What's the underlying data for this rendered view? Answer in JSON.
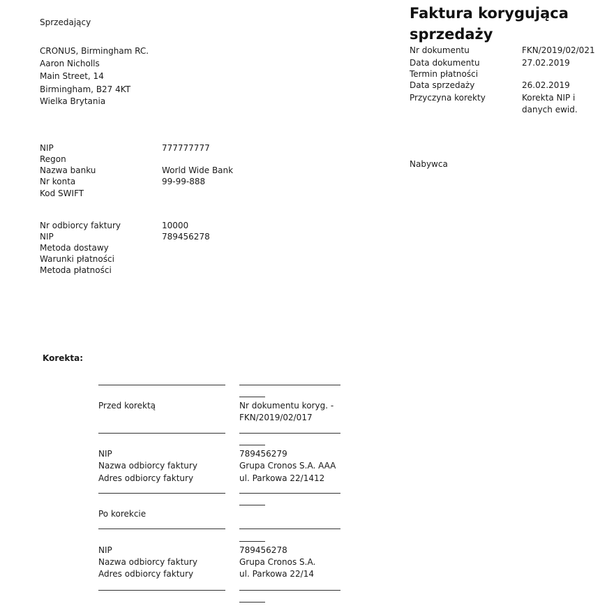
{
  "seller": {
    "heading": "Sprzedający",
    "address": [
      "CRONUS, Birmingham RC.",
      "Aaron Nicholls",
      "Main Street, 14",
      "Birmingham, B27 4KT",
      "Wielka Brytania"
    ]
  },
  "seller_details": [
    {
      "label": "NIP",
      "value": "777777777"
    },
    {
      "label": "Regon",
      "value": ""
    },
    {
      "label": "Nazwa banku",
      "value": "World Wide Bank"
    },
    {
      "label": "Nr konta",
      "value": "99-99-888"
    },
    {
      "label": "Kod SWIFT",
      "value": ""
    }
  ],
  "buyer_details": [
    {
      "label": "Nr odbiorcy faktury",
      "value": "10000"
    },
    {
      "label": "NIP",
      "value": "789456278"
    },
    {
      "label": "Metoda dostawy",
      "value": ""
    },
    {
      "label": "Warunki płatności",
      "value": ""
    },
    {
      "label": "Metoda płatności",
      "value": ""
    }
  ],
  "invoice": {
    "title": "Faktura korygująca sprzedaży",
    "fields": [
      {
        "label": "Nr dokumentu",
        "value": "FKN/2019/02/021"
      },
      {
        "label": "Data dokumentu",
        "value": "27.02.2019"
      },
      {
        "label": "Termin płatności",
        "value": ""
      },
      {
        "label": "Data sprzedaży",
        "value": "26.02.2019"
      },
      {
        "label": "Przyczyna korekty",
        "value": "Korekta NIP i danych ewid."
      }
    ],
    "buyer_heading": "Nabywca"
  },
  "correction": {
    "heading": "Korekta:",
    "before": {
      "label": "Przed korektą",
      "doc_ref": "Nr dokumentu koryg. - FKN/2019/02/017",
      "rows": [
        {
          "label": "NIP",
          "value": "789456279"
        },
        {
          "label": "Nazwa odbiorcy faktury",
          "value": "Grupa Cronos S.A. AAA"
        },
        {
          "label": "Adres odbiorcy faktury",
          "value": "ul. Parkowa 22/1412"
        }
      ]
    },
    "after": {
      "label": "Po korekcie",
      "rows": [
        {
          "label": "NIP",
          "value": "789456278"
        },
        {
          "label": "Nazwa odbiorcy faktury",
          "value": "Grupa Cronos S.A."
        },
        {
          "label": "Adres odbiorcy faktury",
          "value": "ul. Parkowa 22/14"
        }
      ]
    }
  }
}
